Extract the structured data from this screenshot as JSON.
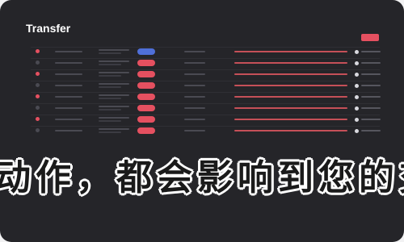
{
  "window": {
    "title": "Transfer"
  },
  "overlay": {
    "text": "动作，都会影响到您的交易"
  },
  "colors": {
    "accent": "#e55060",
    "blue": "#4f6fd8",
    "background": "#252529"
  },
  "table": {
    "rows": [
      {
        "pill_color": "blue"
      },
      {
        "pill_color": "red"
      },
      {
        "pill_color": "red"
      },
      {
        "pill_color": "red"
      },
      {
        "pill_color": "red"
      },
      {
        "pill_color": "red"
      },
      {
        "pill_color": "red"
      },
      {
        "pill_color": "red"
      }
    ]
  }
}
